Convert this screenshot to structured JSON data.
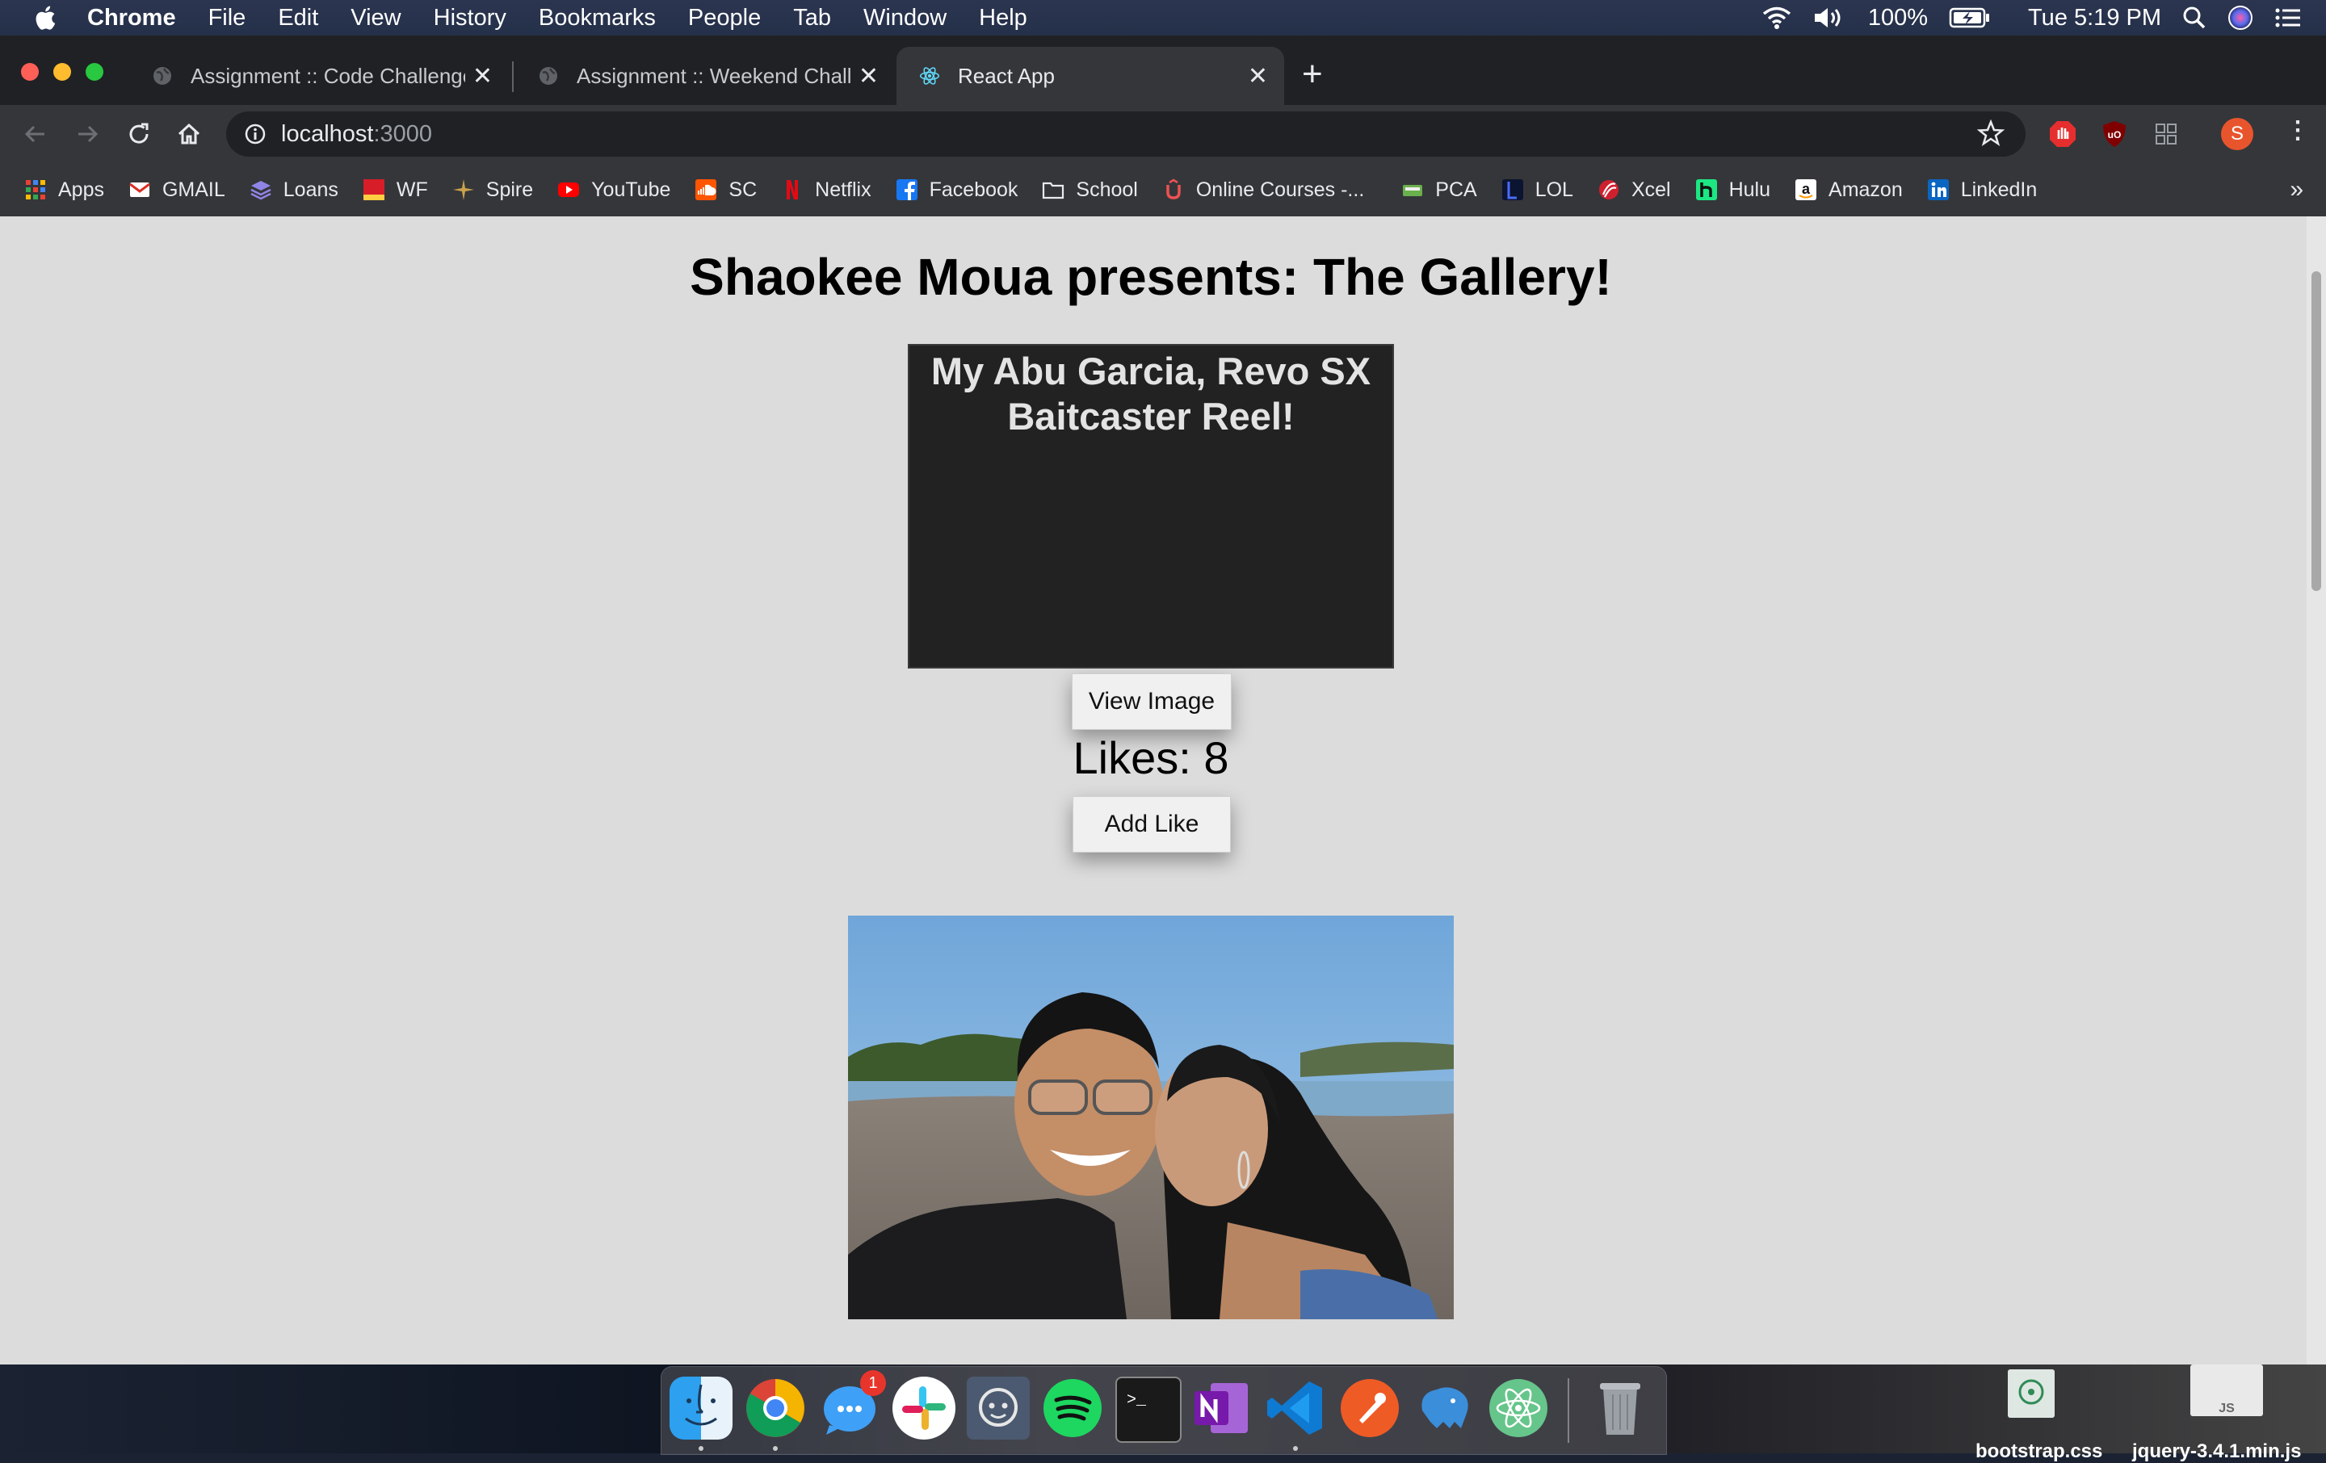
{
  "menubar": {
    "app": "Chrome",
    "items": [
      "File",
      "Edit",
      "View",
      "History",
      "Bookmarks",
      "People",
      "Tab",
      "Window",
      "Help"
    ],
    "battery": "100%",
    "clock": "Tue 5:19 PM"
  },
  "tabs": [
    {
      "title": "Assignment :: Code Challenge",
      "active": false
    },
    {
      "title": "Assignment :: Weekend Challe",
      "active": false
    },
    {
      "title": "React App",
      "active": true
    }
  ],
  "omnibox": {
    "host": "localhost",
    "port": ":3000"
  },
  "profile_initial": "S",
  "bookmarks": [
    {
      "label": "Apps",
      "icon": "apps-grid-icon",
      "color": "#e94235"
    },
    {
      "label": "GMAIL",
      "icon": "gmail-icon",
      "color": "#d93025"
    },
    {
      "label": "Loans",
      "icon": "loans-icon",
      "color": "#7b6fd6"
    },
    {
      "label": "WF",
      "icon": "wells-fargo-icon",
      "color": "#d71e28"
    },
    {
      "label": "Spire",
      "icon": "spire-icon",
      "color": "#c9a24a"
    },
    {
      "label": "YouTube",
      "icon": "youtube-icon",
      "color": "#ff0000"
    },
    {
      "label": "SC",
      "icon": "soundcloud-icon",
      "color": "#ff5500"
    },
    {
      "label": "Netflix",
      "icon": "netflix-icon",
      "color": "#e50914"
    },
    {
      "label": "Facebook",
      "icon": "facebook-icon",
      "color": "#1877f2"
    },
    {
      "label": "School",
      "icon": "folder-icon",
      "color": "#9aa0a6"
    },
    {
      "label": "Online Courses -...",
      "icon": "udemy-icon",
      "color": "#ec5252"
    },
    {
      "label": "PCA",
      "icon": "pca-icon",
      "color": "#6ab04c"
    },
    {
      "label": "LOL",
      "icon": "lol-icon",
      "color": "#1e2a78"
    },
    {
      "label": "Xcel",
      "icon": "xcel-icon",
      "color": "#d0202e"
    },
    {
      "label": "Hulu",
      "icon": "hulu-icon",
      "color": "#1ce783"
    },
    {
      "label": "Amazon",
      "icon": "amazon-icon",
      "color": "#ffffff"
    },
    {
      "label": "LinkedIn",
      "icon": "linkedin-icon",
      "color": "#0a66c2"
    }
  ],
  "page": {
    "title": "Shaokee Moua presents: The Gallery!",
    "card": {
      "description": "My Abu Garcia, Revo SX Baitcaster Reel!",
      "view_button": "View Image",
      "likes_label": "Likes: 8",
      "like_button": "Add Like"
    }
  },
  "dock": {
    "apps": [
      "finder-icon",
      "chrome-icon",
      "messenger-icon",
      "slack-icon",
      "discord-like-icon",
      "spotify-icon",
      "terminal-icon",
      "onenote-icon",
      "vscode-icon",
      "postman-icon",
      "tableplus-icon",
      "atom-icon",
      "trash-icon"
    ],
    "messenger_badge": "1"
  },
  "desktop_files": [
    "bootstrap.css",
    "jquery-3.4.1.min.js"
  ]
}
